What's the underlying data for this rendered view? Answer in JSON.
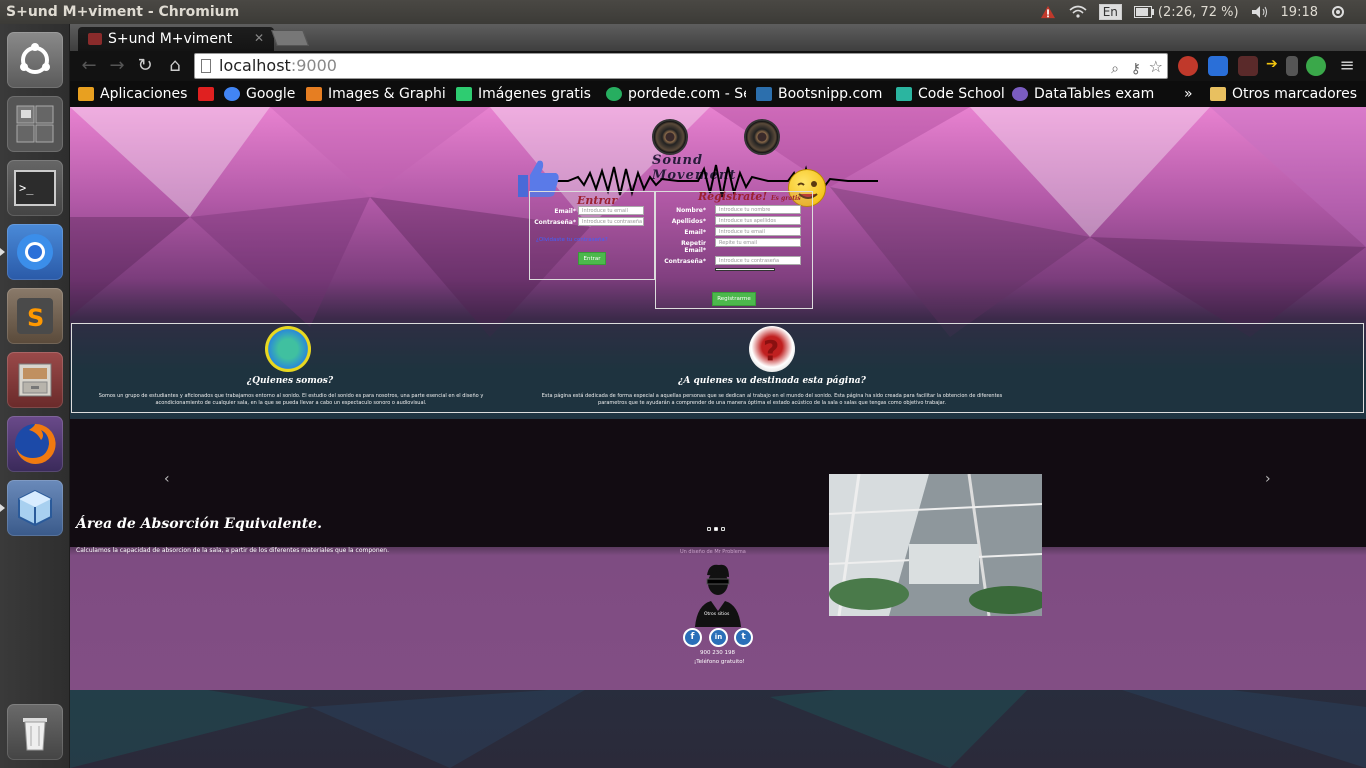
{
  "os": {
    "window_title": "S+und M+viment - Chromium",
    "lang_indicator": "En",
    "battery": "(2:26, 72 %)",
    "clock": "19:18"
  },
  "launcher": {
    "items": [
      "ubuntu-dash",
      "workspaces",
      "terminal",
      "chromium",
      "sublime-text",
      "file-cabinet",
      "firefox",
      "virtualbox",
      "trash"
    ]
  },
  "browser": {
    "tab_title": "S+und M+viment",
    "url_host": "localhost",
    "url_port": ":9000",
    "bookmarks": [
      {
        "label": "Aplicaciones",
        "color": "#e8a020"
      },
      {
        "label": "",
        "color": "#e02020"
      },
      {
        "label": "Google",
        "color": "#4285f4"
      },
      {
        "label": "Images & Graphic",
        "color": "#e67e22"
      },
      {
        "label": "Imágenes gratis -",
        "color": "#2ecc71"
      },
      {
        "label": "pordede.com - Se",
        "color": "#27ae60"
      },
      {
        "label": "Bootsnipp.com",
        "color": "#2c6fad"
      },
      {
        "label": "Code School",
        "color": "#2bb5a0"
      },
      {
        "label": "DataTables exam",
        "color": "#7a5cc0"
      }
    ],
    "bookmarks_overflow": "»",
    "other_bookmarks": "Otros marcadores"
  },
  "page": {
    "logo_text": "Sound Movement",
    "login": {
      "title": "Entrar",
      "email_label": "Email*",
      "email_placeholder": "Introduce tu email",
      "password_label": "Contraseña*",
      "password_placeholder": "Introduce tu contraseña",
      "forgot_link": "¿Olvidaste tu contraseña?",
      "submit": "Entrar"
    },
    "register": {
      "title": "Registrate!",
      "title_suffix": "Es gratis",
      "name_label": "Nombre*",
      "name_placeholder": "Introduce tu nombre",
      "surname_label": "Apellidos*",
      "surname_placeholder": "Introduce tus apellidos",
      "email_label": "Email*",
      "email_placeholder": "Introduce tu email",
      "repeat_label_1": "Repetir",
      "repeat_label_2": "Email*",
      "repeat_placeholder": "Repite tu email",
      "password_label": "Contraseña*",
      "password_placeholder": "Introduce tu contraseña",
      "submit": "Registrarme"
    },
    "about": {
      "title": "¿Quienes somos?",
      "text_line1": "Somos un grupo de estudiantes y aficionados que trabajamos entorno al sonido. El estudio del sonido es para nosotros, una parte esencial en el diseño y",
      "text_line2": "acondicionamiento de cualquier sala, en la que se pueda llevar a cabo un espectaculo sonoro o audiovisual."
    },
    "audience": {
      "title": "¿A quienes va destinada esta página?",
      "text_line1": "Esta página está dedicada de forma especial a aquellas personas que se dedican al trabajo en el mundo del sonido. Esta página ha sido creada para facilitar la obtencion de diferentes",
      "text_line2": "parametros que te ayudarán a comprender de una manera óptima el estado acústico de la sala o salas que tengas como objetivo trabajar."
    },
    "carousel": {
      "slide_title": "Área de Absorción Equivalente.",
      "slide_text": "Calculamos la capacidad de absorcion de la sala, a partir de los diferentes materiales que la componen.",
      "prev": "‹",
      "next": "›",
      "active_index": 2,
      "count": 3
    },
    "footer": {
      "credit": "Un diseño de Mr Problema",
      "avatar_label": "Otros sitios",
      "social": [
        "f",
        "in",
        "t"
      ],
      "phone": "900 230 198",
      "phone_note": "¡Teléfono gratuito!"
    }
  }
}
